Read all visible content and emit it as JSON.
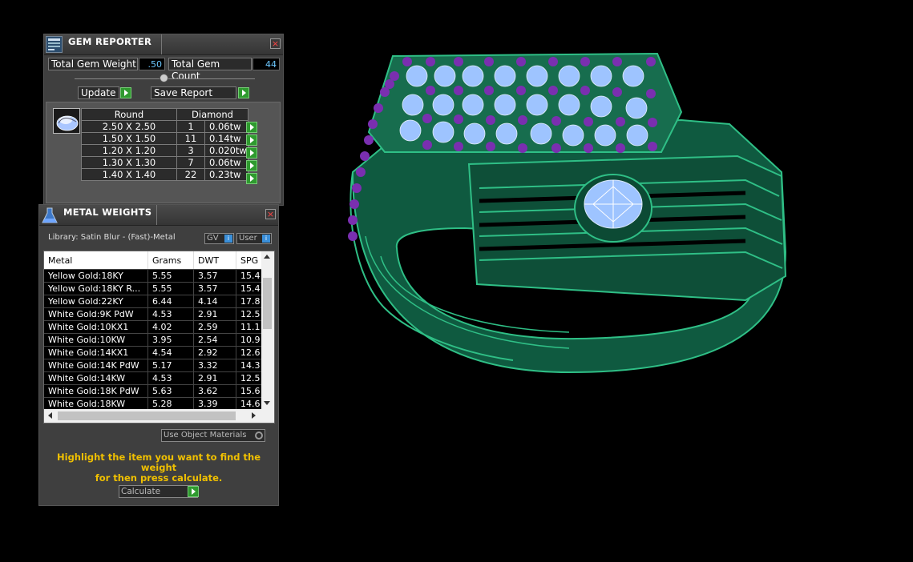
{
  "gem_reporter": {
    "title": "GEM REPORTER",
    "close": "×",
    "total_gem_weight_label": "Total Gem Weight",
    "total_gem_weight_value": ".50",
    "total_gem_count_label": "Total Gem Count",
    "total_gem_count_value": "44",
    "update_label": "Update",
    "save_report_label": "Save Report",
    "table_headers": [
      "Round",
      "Diamond"
    ],
    "rows": [
      {
        "size": "2.50 X 2.50",
        "count": "1",
        "weight": "0.06tw"
      },
      {
        "size": "1.50 X 1.50",
        "count": "11",
        "weight": "0.14tw"
      },
      {
        "size": "1.20 X 1.20",
        "count": "3",
        "weight": "0.020tw"
      },
      {
        "size": "1.30 X 1.30",
        "count": "7",
        "weight": "0.06tw"
      },
      {
        "size": "1.40 X 1.40",
        "count": "22",
        "weight": "0.23tw"
      }
    ]
  },
  "metal_weights": {
    "title": "METAL WEIGHTS",
    "close": "×",
    "library_label": "Library: Satin Blur - (Fast)-Metal",
    "gv_label": "GV",
    "user_label": "User",
    "headers": [
      "Metal",
      "Grams",
      "DWT",
      "SPG"
    ],
    "rows": [
      [
        "Yellow Gold:18KY",
        "5.55",
        "3.57",
        "15.4"
      ],
      [
        "Yellow Gold:18KY R...",
        "5.55",
        "3.57",
        "15.4"
      ],
      [
        "Yellow Gold:22KY",
        "6.44",
        "4.14",
        "17.8"
      ],
      [
        "White Gold:9K PdW",
        "4.53",
        "2.91",
        "12.5"
      ],
      [
        "White Gold:10KX1",
        "4.02",
        "2.59",
        "11.1"
      ],
      [
        "White Gold:10KW",
        "3.95",
        "2.54",
        "10.9"
      ],
      [
        "White Gold:14KX1",
        "4.54",
        "2.92",
        "12.6"
      ],
      [
        "White Gold:14K PdW",
        "5.17",
        "3.32",
        "14.3"
      ],
      [
        "White Gold:14KW",
        "4.53",
        "2.91",
        "12.5"
      ],
      [
        "White Gold:18K PdW",
        "5.63",
        "3.62",
        "15.6"
      ],
      [
        "White Gold:18KW",
        "5.28",
        "3.39",
        "14.6"
      ]
    ],
    "use_object_materials_label": "Use Object Materials",
    "instruction_line1": "Highlight the item you want to find the weight",
    "instruction_line2": "for then press calculate.",
    "calculate_label": "Calculate"
  },
  "colors": {
    "ring_green": "#1f8a64",
    "gem_blue": "#9ec4ff",
    "prong_purple": "#7a2fb0",
    "accent_yellow": "#f0c000",
    "value_blue": "#6cc8ff"
  }
}
